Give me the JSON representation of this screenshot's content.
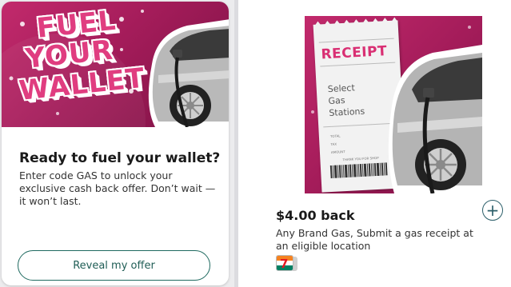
{
  "colors": {
    "brand_magenta": "#a41c5a",
    "title_pink": "#e03d80",
    "button_border": "#1f6a60",
    "add_icon": "#2a5e69"
  },
  "promo_card": {
    "hero_words": [
      "FUEL",
      "YOUR",
      "WALLET"
    ],
    "title": "Ready to fuel your wallet?",
    "body": "Enter code GAS to unlock your exclusive cash back offer. Don’t wait — it won’t last.",
    "button_label": "Reveal my offer"
  },
  "offer_card": {
    "receipt": {
      "heading": "RECEIPT",
      "lines": [
        "Select",
        "Gas",
        "Stations"
      ],
      "total_label": "TOTAL",
      "tax_label": "TAX",
      "amount_label": "AMOUNT",
      "thanks": "THANK YOU FOR SHOP"
    },
    "amount": "$4.00 back",
    "description": "Any Brand Gas, Submit a gas receipt at an eligible location",
    "add_icon": "plus-circle-icon",
    "store_icon": "seven-eleven-logo-icon"
  }
}
